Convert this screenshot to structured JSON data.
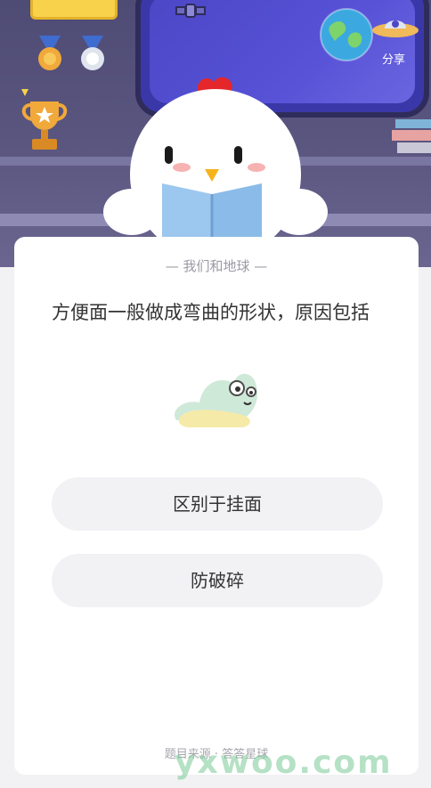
{
  "header": {
    "share_label": "分享"
  },
  "question": {
    "topic": "— 我们和地球 —",
    "text": "方便面一般做成弯曲的形状，原因包括"
  },
  "options": [
    {
      "label": "区别于挂面"
    },
    {
      "label": "防破碎"
    }
  ],
  "footer": {
    "source": "题目来源 · 答答星球"
  },
  "watermark": {
    "text": "yxwoo.com"
  },
  "colors": {
    "background": "#f2f2f4",
    "scene": "#4e4b74",
    "panel": "#5752d6",
    "option_bg": "#f2f2f5",
    "text_primary": "#333333",
    "text_secondary": "#9a9aa4"
  },
  "icons": [
    "medal-icon",
    "trophy-icon",
    "earth-icon",
    "ufo-share-icon",
    "chicken-mascot",
    "snail-mascot",
    "satellite-icon",
    "books-icon"
  ]
}
